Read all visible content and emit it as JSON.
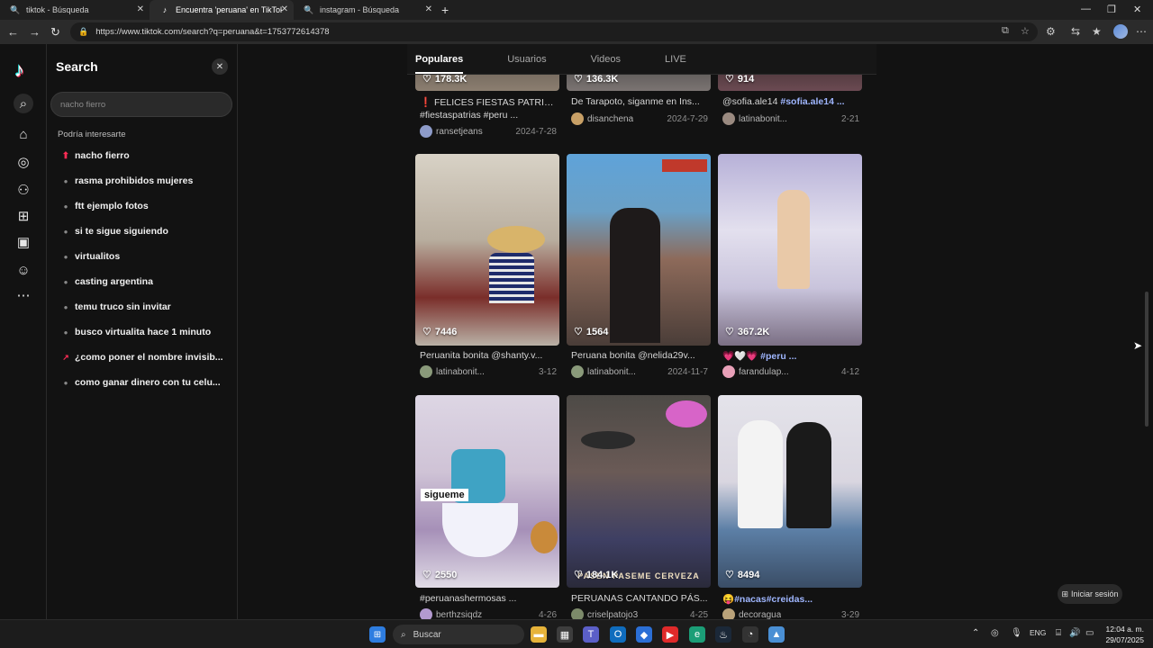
{
  "browser": {
    "tabs": [
      {
        "title": "tiktok - Búsqueda",
        "active": false
      },
      {
        "title": "Encuentra 'peruana' en TikTok | B",
        "active": true
      },
      {
        "title": "instagram - Búsqueda",
        "active": false
      }
    ],
    "new_tab": "+",
    "url": "https://www.tiktok.com/search?q=peruana&t=1753772614378"
  },
  "search_panel": {
    "title": "Search",
    "placeholder": "nacho fierro",
    "subtitle": "Podría interesarte",
    "suggestions": [
      {
        "text": "nacho fierro",
        "kind": "hot"
      },
      {
        "text": "rasma prohibidos mujeres",
        "kind": "dot"
      },
      {
        "text": "ftt ejemplo fotos",
        "kind": "dot"
      },
      {
        "text": "si te sigue siguiendo",
        "kind": "dot"
      },
      {
        "text": "virtualitos",
        "kind": "dot"
      },
      {
        "text": "casting argentina",
        "kind": "dot"
      },
      {
        "text": "temu truco sin invitar",
        "kind": "dot"
      },
      {
        "text": "busco virtualita hace 1 minuto",
        "kind": "dot"
      },
      {
        "text": "¿como poner el nombre invisib...",
        "kind": "trend"
      },
      {
        "text": "como ganar dinero con tu celu...",
        "kind": "dot"
      }
    ]
  },
  "result_tabs": [
    "Populares",
    "Usuarios",
    "Videos",
    "LIVE"
  ],
  "videos": [
    {
      "likes": "178.3K",
      "caption_pre": "❗ FELICES FIESTAS PATRIA...",
      "caption_tags": "",
      "caption_line2": "#fiestaspatrias #peru ...",
      "user": "ransetjeans",
      "date": "2024-7-28"
    },
    {
      "likes": "136.3K",
      "caption_pre": "De Tarapoto, siganme en Ins...",
      "caption_tags": "",
      "caption_line2": "",
      "user": "disanchena",
      "date": "2024-7-29"
    },
    {
      "likes": "914",
      "caption_pre": "@sofia.ale14 ",
      "caption_tags": "#sofia.ale14 ...",
      "caption_line2": "",
      "user": "latinabonit...",
      "date": "2-21"
    },
    {
      "likes": "7446",
      "caption_pre": "Peruanita bonita @shanty.v...",
      "caption_tags": "",
      "caption_line2": "",
      "user": "latinabonit...",
      "date": "3-12"
    },
    {
      "likes": "1564",
      "caption_pre": "Peruana bonita @nelida29v...",
      "caption_tags": "",
      "caption_line2": "",
      "user": "latinabonit...",
      "date": "2024-11-7"
    },
    {
      "likes": "367.2K",
      "caption_pre": "💗🤍💗 ",
      "caption_tags": "#peru ...",
      "caption_line2": "",
      "user": "farandulap...",
      "date": "4-12"
    },
    {
      "likes": "2550",
      "caption_pre": "",
      "caption_tags": "#peruanashermosas ...",
      "caption_line2": "",
      "user": "berthzsiqdz",
      "date": "4-26",
      "overlay": "sigueme"
    },
    {
      "likes": "184.1K",
      "caption_pre": "PERUANAS CANTANDO PÁS...",
      "caption_tags": "",
      "caption_line2": "",
      "user": "criselpatojo3",
      "date": "4-25",
      "overlay": "PASEN PASEME CERVEZA"
    },
    {
      "likes": "8494",
      "caption_pre": "😝",
      "caption_tags": "#nacas#creidas...",
      "caption_line2": "",
      "user": "decoragua",
      "date": "3-29"
    }
  ],
  "login_label": "Iniciar sesión",
  "taskbar": {
    "search_label": "Buscar",
    "lang": "ENG",
    "time": "12:04 a. m.",
    "date": "29/07/2025"
  },
  "colors": {
    "accent": "#fe2c55",
    "link": "#9fb6ff",
    "bg": "#121212"
  }
}
